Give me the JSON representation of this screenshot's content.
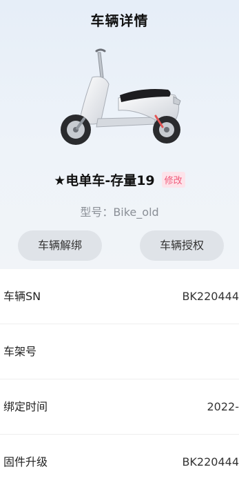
{
  "header": {
    "title": "车辆详情"
  },
  "vehicle": {
    "name": "★电单车-存量19",
    "edit_label": "修改",
    "model_text": "型号：Bike_old"
  },
  "actions": {
    "unbind_label": "车辆解绑",
    "authorize_label": "车辆授权"
  },
  "details": [
    {
      "label": "车辆SN",
      "value": "BK220444"
    },
    {
      "label": "车架号",
      "value": ""
    },
    {
      "label": "绑定时间",
      "value": "2022-"
    },
    {
      "label": "固件升级",
      "value": "BK220444"
    }
  ],
  "colors": {
    "hero_background": "#e6eef8",
    "edit_tag_text": "#ef5a7a",
    "edit_tag_background": "#fde3ea",
    "button_background": "#dfe3e8",
    "secondary_text": "#8a8f96"
  },
  "icons": {
    "vehicle_image": "scooter-illustration"
  }
}
